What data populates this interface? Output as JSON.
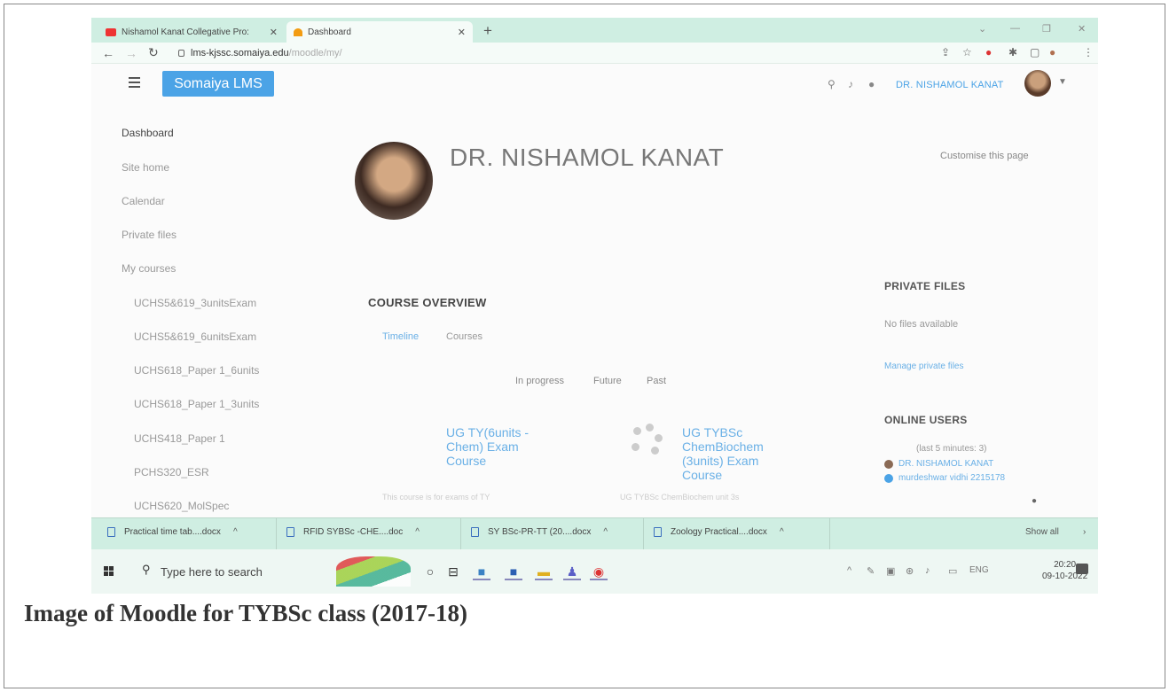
{
  "browser": {
    "tabs": [
      {
        "title": "Nishamol Kanat Collegative Pro:",
        "icon": "youtube-icon",
        "active": false
      },
      {
        "title": "Dashboard",
        "icon": "moodle-icon",
        "active": true
      }
    ],
    "url_host": "lms-kjssc.somaiya.edu",
    "url_path": "/moodle/my/"
  },
  "header": {
    "brand": "Somaiya LMS",
    "user_name": "DR. NISHAMOL KANAT"
  },
  "leftnav": {
    "items": [
      "Dashboard",
      "Site home",
      "Calendar",
      "Private files",
      "My courses",
      "UCHS5&619_3unitsExam",
      "UCHS5&619_6unitsExam",
      "UCHS618_Paper 1_6units",
      "UCHS618_Paper 1_3units",
      "UCHS418_Paper 1",
      "PCHS320_ESR",
      "UCHS620_MolSpec"
    ]
  },
  "profile": {
    "full_name": "DR. NISHAMOL KANAT",
    "customise": "Customise this page"
  },
  "course_overview": {
    "title": "COURSE OVERVIEW",
    "tabs": [
      "Timeline",
      "Courses"
    ],
    "filters": [
      "In progress",
      "Future",
      "Past"
    ],
    "courses": [
      {
        "name_lines": [
          "UG TY(6units -",
          "Chem) Exam",
          "Course"
        ],
        "summary": "This course is for exams of TY"
      },
      {
        "name_lines": [
          "UG TYBSc",
          "ChemBiochem",
          "(3units) Exam",
          "Course"
        ],
        "summary": "UG TYBSc ChemBiochem unit 3s"
      }
    ]
  },
  "private_files": {
    "title": "PRIVATE FILES",
    "empty_text": "No files available",
    "manage_link": "Manage private files"
  },
  "online_users": {
    "title": "ONLINE USERS",
    "subtitle": "(last 5 minutes: 3)",
    "users": [
      {
        "name": "DR. NISHAMOL KANAT",
        "color": "#8a6a55"
      },
      {
        "name": "murdeshwar vidhi 2215178",
        "color": "#4ba3e6"
      }
    ]
  },
  "downloads": {
    "items": [
      "Practical time tab....docx",
      "RFID SYBSc -CHE....doc",
      "SY BSc-PR-TT (20....docx",
      "Zoology Practical....docx"
    ],
    "show_all": "Show all"
  },
  "taskbar": {
    "search_placeholder": "Type here to search",
    "lang": "ENG",
    "time": "20:20",
    "date": "09-10-2022"
  },
  "caption": "Image of Moodle for TYBSc class (2017-18)",
  "colors": {
    "accent": "#4ba3e6",
    "tabbar": "#cfeee2"
  }
}
